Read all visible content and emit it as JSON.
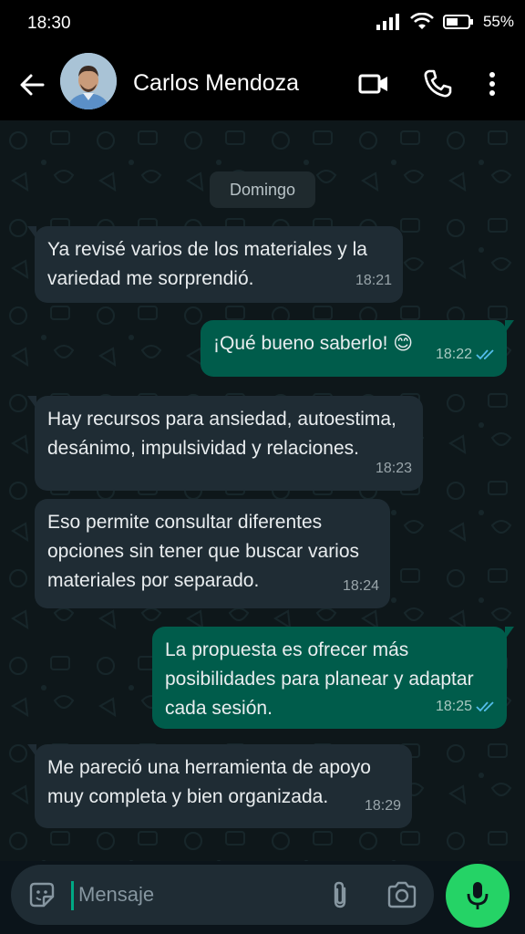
{
  "status_bar": {
    "time": "18:30",
    "battery": "55%"
  },
  "header": {
    "contact_name": "Carlos Mendoza"
  },
  "chat": {
    "date_separator": "Domingo",
    "messages": [
      {
        "direction": "in",
        "text_lines": [
          "Ya revisé varios de los materiales y la",
          "variedad me sorprendió."
        ],
        "time": "18:21"
      },
      {
        "direction": "out",
        "text_lines": [
          "¡Qué bueno saberlo! 😊"
        ],
        "time": "18:22",
        "status": "read"
      },
      {
        "direction": "in",
        "text_lines": [
          "Hay recursos para ansiedad, autoestima,",
          "desánimo, impulsividad y relaciones."
        ],
        "time": "18:23"
      },
      {
        "direction": "in",
        "text_lines": [
          "Eso permite consultar diferentes",
          "opciones sin tener que buscar varios",
          "materiales por separado."
        ],
        "time": "18:24"
      },
      {
        "direction": "out",
        "text_lines": [
          "La propuesta es ofrecer más",
          "posibilidades para planear y adaptar",
          "cada sesión."
        ],
        "time": "18:25",
        "status": "read"
      },
      {
        "direction": "in",
        "text_lines": [
          "Me pareció una herramienta de apoyo",
          "muy completa y bien organizada."
        ],
        "time": "18:29"
      }
    ]
  },
  "input": {
    "placeholder": "Mensaje"
  },
  "icons": {
    "back": "arrow-left-icon",
    "video": "video-call-icon",
    "call": "phone-icon",
    "menu": "more-vert-icon",
    "emoji": "emoji-sticker-icon",
    "attach": "paperclip-icon",
    "camera": "camera-icon",
    "mic": "microphone-icon",
    "read_receipt": "double-check-icon"
  },
  "colors": {
    "incoming_bubble": "#1f2c34",
    "outgoing_bubble": "#005c4b",
    "accent": "#25d366",
    "read_check": "#53bdeb",
    "header_bg": "#000000",
    "chat_bg": "#0e171a"
  }
}
